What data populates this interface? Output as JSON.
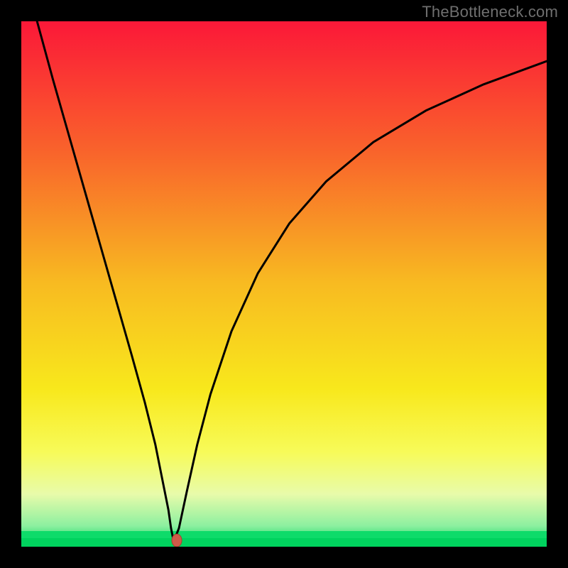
{
  "watermark": "TheBottleneck.com",
  "colors": {
    "frame": "#000000",
    "watermark": "#6f6f6f",
    "curve": "#000000",
    "top_green": "#0edb6a",
    "bottom_green": "#00d35e",
    "marker_fill": "#cf5b49",
    "marker_stroke": "#a8402f",
    "gradient_stops": [
      {
        "offset": 0,
        "color": "#fb1838"
      },
      {
        "offset": 25,
        "color": "#f9642b"
      },
      {
        "offset": 50,
        "color": "#f8bb21"
      },
      {
        "offset": 70,
        "color": "#f8e81c"
      },
      {
        "offset": 82,
        "color": "#f7fb59"
      },
      {
        "offset": 90,
        "color": "#e8fbaa"
      },
      {
        "offset": 96,
        "color": "#8df0a0"
      },
      {
        "offset": 100,
        "color": "#00d35e"
      }
    ]
  },
  "chart_data": {
    "type": "line",
    "title": "",
    "xlabel": "",
    "ylabel": "",
    "xlim": [
      0,
      1000
    ],
    "ylim": [
      0,
      1000
    ],
    "curve_description": "V-shaped bottleneck curve with sharp minimum near x≈290",
    "minimum_point": {
      "x": 290,
      "y": 10
    },
    "series": [
      {
        "name": "bottleneck-curve",
        "color": "#000000",
        "x": [
          30,
          60,
          90,
          120,
          150,
          180,
          210,
          235,
          255,
          270,
          280,
          285,
          290,
          300,
          315,
          335,
          360,
          400,
          450,
          510,
          580,
          670,
          770,
          880,
          1000
        ],
        "values": [
          1000,
          890,
          785,
          680,
          575,
          470,
          365,
          275,
          195,
          120,
          70,
          35,
          10,
          35,
          105,
          195,
          290,
          410,
          520,
          615,
          695,
          770,
          830,
          880,
          924
        ]
      }
    ],
    "marker": {
      "x": 296,
      "y": 12
    }
  }
}
